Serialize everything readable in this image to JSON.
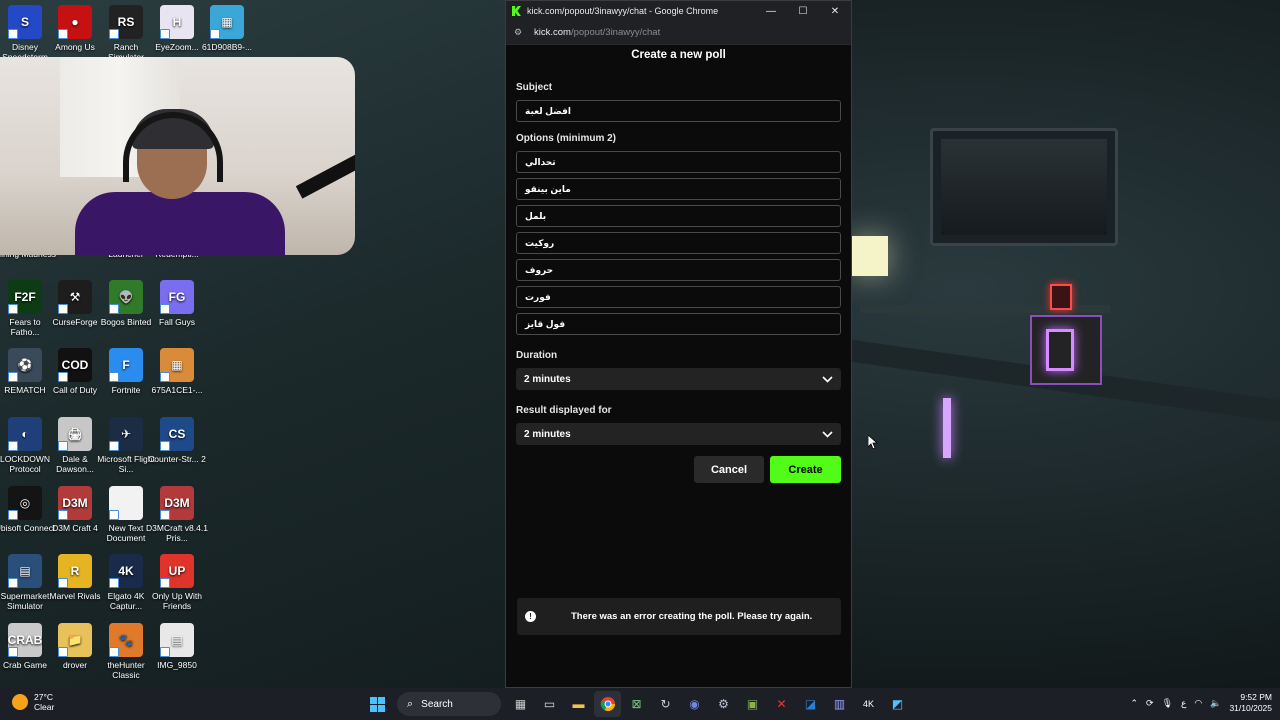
{
  "desktop": {
    "icons": [
      {
        "label": "Disney Speedstorm",
        "color": "#2349c7",
        "glyph": "S",
        "col": 0,
        "row": 0
      },
      {
        "label": "Among Us",
        "color": "#c51111",
        "glyph": "●",
        "col": 1,
        "row": 0
      },
      {
        "label": "Ranch Simulator",
        "color": "#222222",
        "glyph": "RS",
        "col": 2,
        "row": 0
      },
      {
        "label": "EyeZoom...",
        "color": "#e9e4f2",
        "glyph": "H",
        "col": 3,
        "row": 0
      },
      {
        "label": "61D908B9-...",
        "color": "#3ba7d9",
        "glyph": "▦",
        "col": 4,
        "row": 0
      },
      {
        "label": "Mining Madness",
        "color": "#5a4632",
        "glyph": "",
        "col": 0,
        "row": 3
      },
      {
        "label": "Launcher",
        "color": "#444444",
        "glyph": "",
        "col": 2,
        "row": 3
      },
      {
        "label": "Redempti...",
        "color": "#6b2b1f",
        "glyph": "",
        "col": 3,
        "row": 3
      },
      {
        "label": "Fears to Fatho...",
        "color": "#0d3b13",
        "glyph": "F2F",
        "col": 0,
        "row": 4
      },
      {
        "label": "CurseForge",
        "color": "#1d1d1d",
        "glyph": "⚒",
        "col": 1,
        "row": 4
      },
      {
        "label": "Bogos Binted",
        "color": "#2f7b2a",
        "glyph": "👽",
        "col": 2,
        "row": 4
      },
      {
        "label": "Fall Guys",
        "color": "#7a6df0",
        "glyph": "FG",
        "col": 3,
        "row": 4
      },
      {
        "label": "REMATCH",
        "color": "#3a4a5a",
        "glyph": "⚽",
        "col": 0,
        "row": 5
      },
      {
        "label": "Call of Duty",
        "color": "#111111",
        "glyph": "COD",
        "col": 1,
        "row": 5
      },
      {
        "label": "Fortnite",
        "color": "#2b8cf0",
        "glyph": "F",
        "col": 2,
        "row": 5
      },
      {
        "label": "675A1CE1-...",
        "color": "#d98b3a",
        "glyph": "▦",
        "col": 3,
        "row": 5
      },
      {
        "label": "LOCKDOWN Protocol",
        "color": "#1e3f7a",
        "glyph": "◐",
        "col": 0,
        "row": 6
      },
      {
        "label": "Dale & Dawson...",
        "color": "#c7c7c7",
        "glyph": "🖨",
        "col": 1,
        "row": 6
      },
      {
        "label": "Microsoft Flight Si...",
        "color": "#1c2c44",
        "glyph": "✈",
        "col": 2,
        "row": 6
      },
      {
        "label": "Counter-Str... 2",
        "color": "#1f4a8a",
        "glyph": "CS",
        "col": 3,
        "row": 6
      },
      {
        "label": "Ubisoft Connect",
        "color": "#141414",
        "glyph": "◎",
        "col": 0,
        "row": 7
      },
      {
        "label": "D3M Craft 4",
        "color": "#b23a3a",
        "glyph": "D3M",
        "col": 1,
        "row": 7
      },
      {
        "label": "New Text Document",
        "color": "#f2f2f2",
        "glyph": "",
        "col": 2,
        "row": 7
      },
      {
        "label": "D3MCraft v8.4.1 Pris...",
        "color": "#b23a3a",
        "glyph": "D3M",
        "col": 3,
        "row": 7
      },
      {
        "label": "Supermarket Simulator",
        "color": "#2a4f7a",
        "glyph": "▤",
        "col": 0,
        "row": 8
      },
      {
        "label": "Marvel Rivals",
        "color": "#e6b422",
        "glyph": "R",
        "col": 1,
        "row": 8
      },
      {
        "label": "Elgato 4K Captur...",
        "color": "#1a2a4a",
        "glyph": "4K",
        "col": 2,
        "row": 8
      },
      {
        "label": "Only Up With Friends",
        "color": "#e0342b",
        "glyph": "UP",
        "col": 3,
        "row": 8
      },
      {
        "label": "Crab Game",
        "color": "#c9c9c9",
        "glyph": "CRAB",
        "col": 0,
        "row": 9
      },
      {
        "label": "drover",
        "color": "#e8c15a",
        "glyph": "📁",
        "col": 1,
        "row": 9
      },
      {
        "label": "theHunter Classic",
        "color": "#e07a2a",
        "glyph": "🐾",
        "col": 2,
        "row": 9
      },
      {
        "label": "IMG_9850",
        "color": "#e8e8e8",
        "glyph": "▤",
        "col": 3,
        "row": 9
      }
    ]
  },
  "browser": {
    "window_title": "kick.com/popout/3inawyy/chat - Google Chrome",
    "address_host": "kick.com",
    "address_path": "/popout/3inawyy/chat",
    "minimize_glyph": "—",
    "maximize_glyph": "☐",
    "close_glyph": "✕"
  },
  "poll": {
    "heading": "Create a new poll",
    "subject_label": "Subject",
    "subject_value": "افضل لعبة",
    "options_label": "Options (minimum 2)",
    "options": [
      "تحدالي",
      "ماين بينقو",
      "بلمل",
      "روكيت",
      "حروف",
      "فورت",
      "فول قايز"
    ],
    "duration_label": "Duration",
    "duration_value": "2 minutes",
    "result_label": "Result displayed for",
    "result_value": "2 minutes",
    "cancel_label": "Cancel",
    "create_label": "Create",
    "error_message": "There was an error creating the poll. Please try again.",
    "error_icon": "!",
    "accent_color": "#53fc18"
  },
  "taskbar": {
    "temperature": "27°C",
    "weather_text": "Clear",
    "search_label": "Search",
    "input_indicator": "ع",
    "time": "9:52 PM",
    "date": "31/10/2025"
  }
}
